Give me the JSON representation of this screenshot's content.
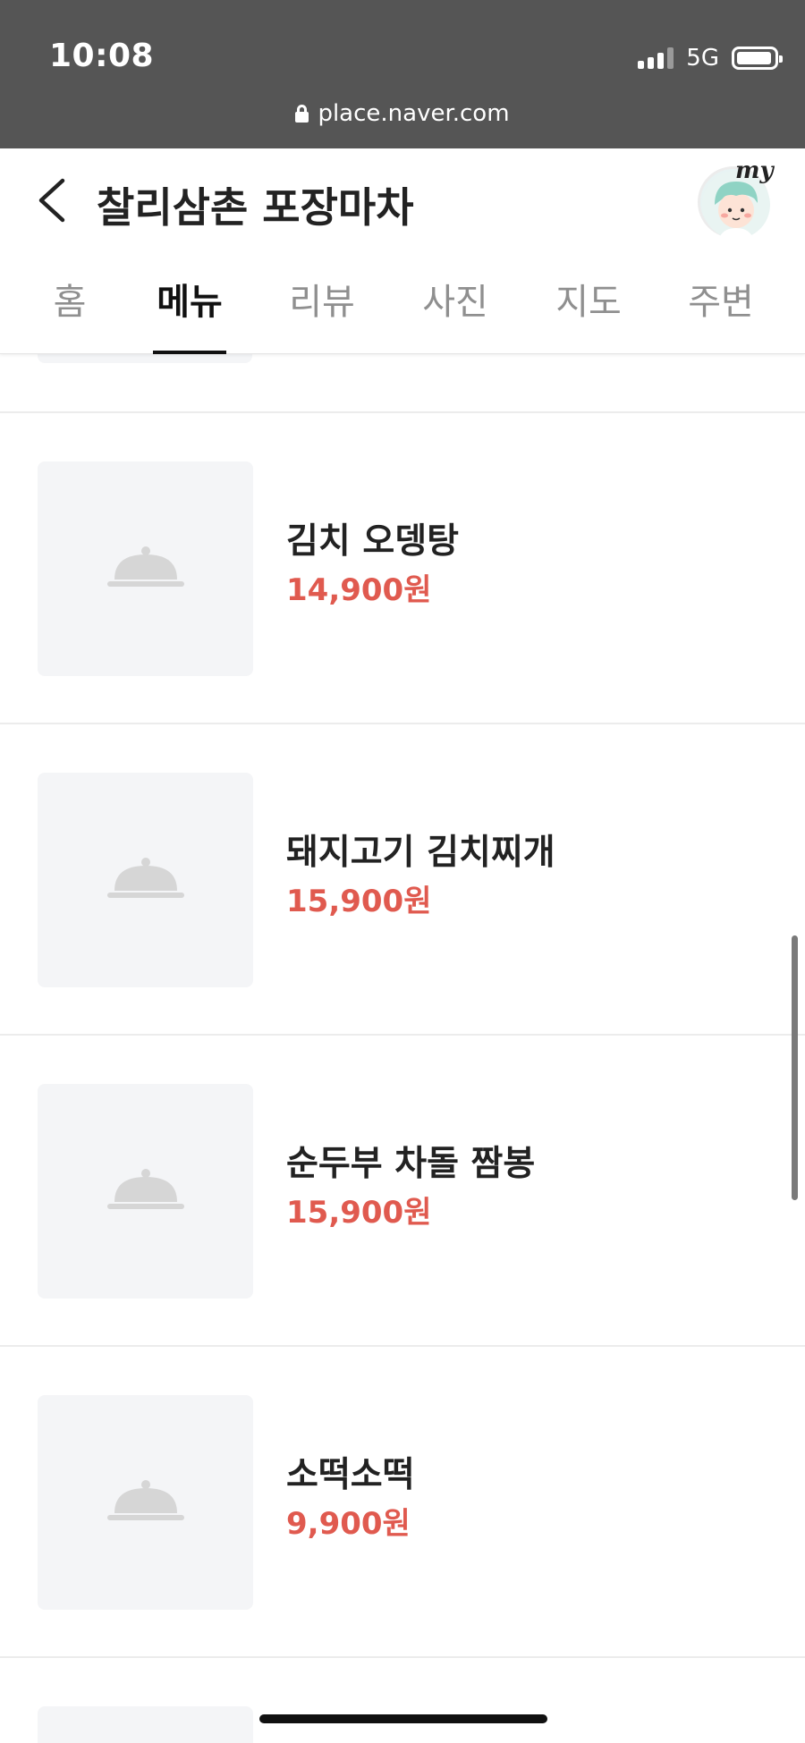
{
  "status_bar": {
    "time": "10:08",
    "network": "5G"
  },
  "browser": {
    "url": "place.naver.com"
  },
  "header": {
    "title": "찰리삼촌 포장마차",
    "my_label": "my"
  },
  "tabs": [
    {
      "label": "홈",
      "active": false
    },
    {
      "label": "메뉴",
      "active": true
    },
    {
      "label": "리뷰",
      "active": false
    },
    {
      "label": "사진",
      "active": false
    },
    {
      "label": "지도",
      "active": false
    },
    {
      "label": "주변",
      "active": false
    }
  ],
  "menu_items": [
    {
      "name": "김치 오뎅탕",
      "price": "14,900원"
    },
    {
      "name": "돼지고기 김치찌개",
      "price": "15,900원"
    },
    {
      "name": "순두부 차돌 짬봉",
      "price": "15,900원"
    },
    {
      "name": "소떡소떡",
      "price": "9,900원"
    }
  ],
  "colors": {
    "price": "#e05a4f",
    "status_bar": "#555555",
    "thumb_bg": "#f4f5f7"
  }
}
